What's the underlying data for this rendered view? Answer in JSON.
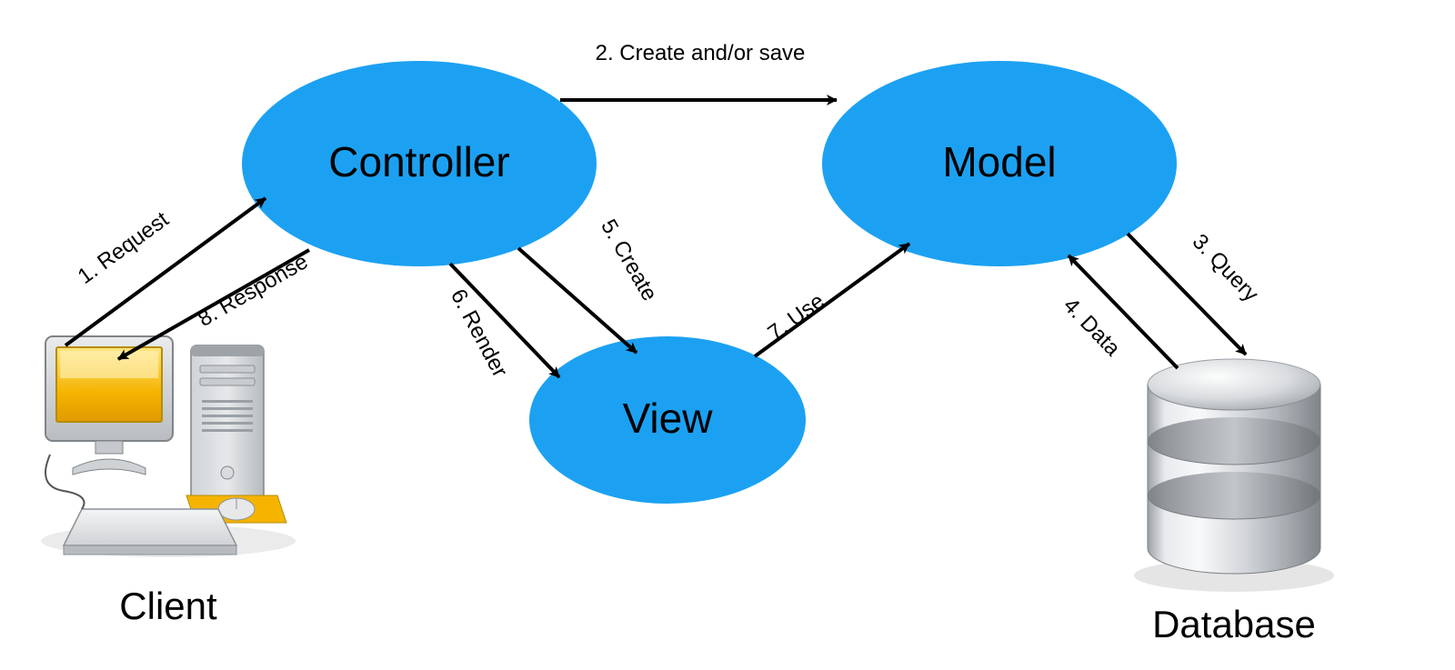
{
  "nodes": {
    "controller": "Controller",
    "model": "Model",
    "view": "View",
    "client": "Client",
    "database": "Database"
  },
  "edges": {
    "e1": "1. Request",
    "e2": "2. Create and/or save",
    "e3": "3. Query",
    "e4": "4. Data",
    "e5": "5. Create",
    "e6": "6. Render",
    "e7": "7. Use",
    "e8": "8. Response"
  },
  "colors": {
    "node_fill": "#1ca1f2",
    "arrow": "#000000"
  }
}
